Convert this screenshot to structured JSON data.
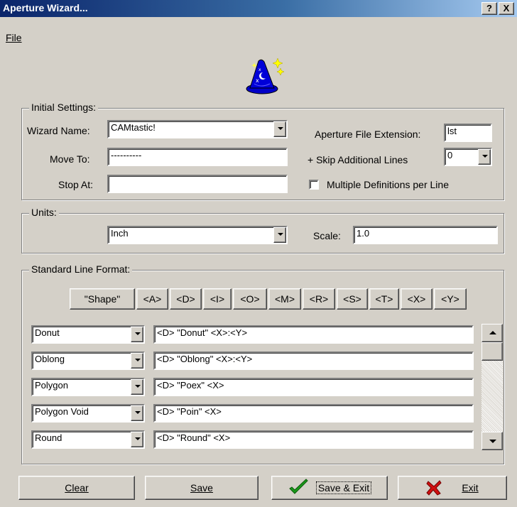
{
  "window": {
    "title": "Aperture Wizard...",
    "help_glyph": "?",
    "close_glyph": "X"
  },
  "menu": {
    "file": "File"
  },
  "logo": {
    "icon": "wizard-hat-icon"
  },
  "initial_settings": {
    "group_label": "Initial Settings:",
    "wizard_name_label": "Wizard Name:",
    "wizard_name_value": "CAMtastic!",
    "move_to_label": "Move To:",
    "move_to_value": "----------",
    "stop_at_label": "Stop At:",
    "stop_at_value": "",
    "aperture_ext_label": "Aperture File Extension:",
    "aperture_ext_value": "lst",
    "skip_lines_label": "+  Skip Additional Lines",
    "skip_lines_value": "0",
    "multiple_defs_label": "Multiple Definitions per Line",
    "multiple_defs_checked": false
  },
  "units": {
    "group_label": "Units:",
    "unit_value": "Inch",
    "scale_label": "Scale:",
    "scale_value": "1.0"
  },
  "line_format": {
    "group_label": "Standard Line Format:",
    "tokens": [
      "\"Shape\"",
      "<A>",
      "<D>",
      "<I>",
      "<O>",
      "<M>",
      "<R>",
      "<S>",
      "<T>",
      "<X>",
      "<Y>"
    ],
    "rows": [
      {
        "shape": "Donut",
        "format": "<D> \"Donut\" <X>:<Y>"
      },
      {
        "shape": "Oblong",
        "format": "<D> \"Oblong\" <X>:<Y>"
      },
      {
        "shape": "Polygon",
        "format": "<D> \"Poex\" <X>"
      },
      {
        "shape": "Polygon Void",
        "format": "<D> \"Poin\" <X>"
      },
      {
        "shape": "Round",
        "format": "<D> \"Round\" <X>"
      }
    ]
  },
  "buttons": {
    "clear": "Clear",
    "save": "Save",
    "save_exit": "Save & Exit",
    "exit": "Exit"
  },
  "colors": {
    "titlebar_start": "#0a246a",
    "titlebar_end": "#a6caf0",
    "check_green": "#1a9a1a",
    "exit_red": "#d01010"
  }
}
